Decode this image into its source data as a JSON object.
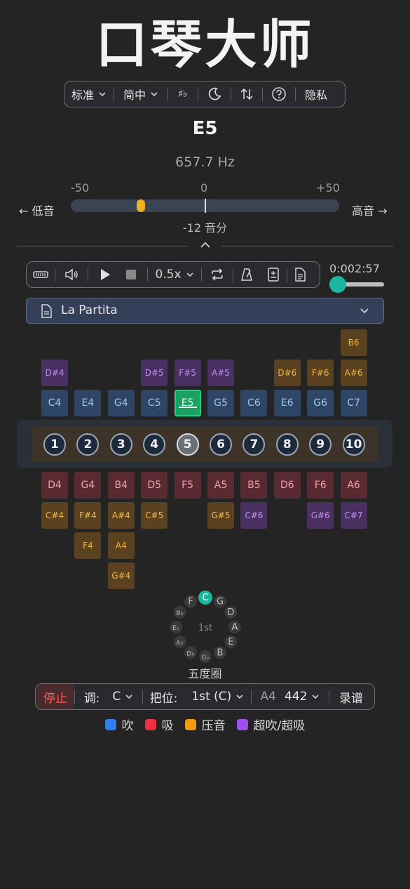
{
  "app_title": "口琴大师",
  "toolbar": {
    "tuning": "标准",
    "language": "简中",
    "accidental_icon": "sharp-flat-icon",
    "theme_icon": "moon-icon",
    "sort_icon": "swap-vertical-icon",
    "help_icon": "help-icon",
    "privacy": "隐私"
  },
  "tuner": {
    "note": "E5",
    "frequency": "657.7 Hz",
    "scale_min": "-50",
    "scale_mid": "0",
    "scale_max": "+50",
    "low_label": "← 低音",
    "high_label": "高音 →",
    "cents": -12,
    "cents_text": "-12 音分",
    "indicator_color": "#f0b020"
  },
  "player": {
    "speed": "0.5x",
    "elapsed": "0:00",
    "total": "2:57",
    "progress": 0.0
  },
  "song": {
    "name": "La Partita"
  },
  "harmonica": {
    "holes": [
      "1",
      "2",
      "3",
      "4",
      "5",
      "6",
      "7",
      "8",
      "9",
      "10"
    ],
    "active_hole": 5,
    "blow_row": [
      "C4",
      "E4",
      "G4",
      "C5",
      "E5",
      "G5",
      "C6",
      "E6",
      "G6",
      "C7"
    ],
    "over_blow_row": [
      "D#4",
      "",
      "",
      "D#5",
      "F#5",
      "A#5",
      "",
      "",
      "",
      ""
    ],
    "blow_bend_row1": [
      "",
      "",
      "",
      "",
      "",
      "",
      "",
      "D#6",
      "F#6",
      "A#6"
    ],
    "blow_bend_row2": [
      "",
      "",
      "",
      "",
      "",
      "",
      "",
      "",
      "",
      "B6"
    ],
    "draw_row": [
      "D4",
      "G4",
      "B4",
      "D5",
      "F5",
      "A5",
      "B5",
      "D6",
      "F6",
      "A6"
    ],
    "draw_bend_row1": [
      "C#4",
      "F#4",
      "A#4",
      "C#5",
      "",
      "G#5",
      "C#6",
      "",
      "G#6",
      "C#7"
    ],
    "draw_bend_row2": [
      "",
      "F4",
      "A4",
      "",
      "",
      "",
      "",
      "",
      "",
      ""
    ],
    "draw_bend_row3": [
      "",
      "",
      "G#4",
      "",
      "",
      "",
      "",
      "",
      "",
      ""
    ],
    "active_note": "E5"
  },
  "circle_of_fifths": {
    "label": "五度圈",
    "center": "1st",
    "keys": [
      "C",
      "G",
      "D",
      "A",
      "E",
      "B",
      "G♭",
      "D♭",
      "A♭",
      "E♭",
      "B♭",
      "F"
    ],
    "selected": "C",
    "selected_color": "#1bb8a0"
  },
  "bottombar": {
    "stop": "停止",
    "key_label": "调:",
    "key_value": "C",
    "position_label": "把位:",
    "position_value": "1st (C)",
    "a4_label": "A4",
    "a4_value": "442",
    "record": "录谱"
  },
  "legend": [
    {
      "label": "吹",
      "color": "#2f7cf6"
    },
    {
      "label": "吸",
      "color": "#ee3040"
    },
    {
      "label": "压音",
      "color": "#f59a10"
    },
    {
      "label": "超吹/超吸",
      "color": "#a050f0"
    }
  ]
}
